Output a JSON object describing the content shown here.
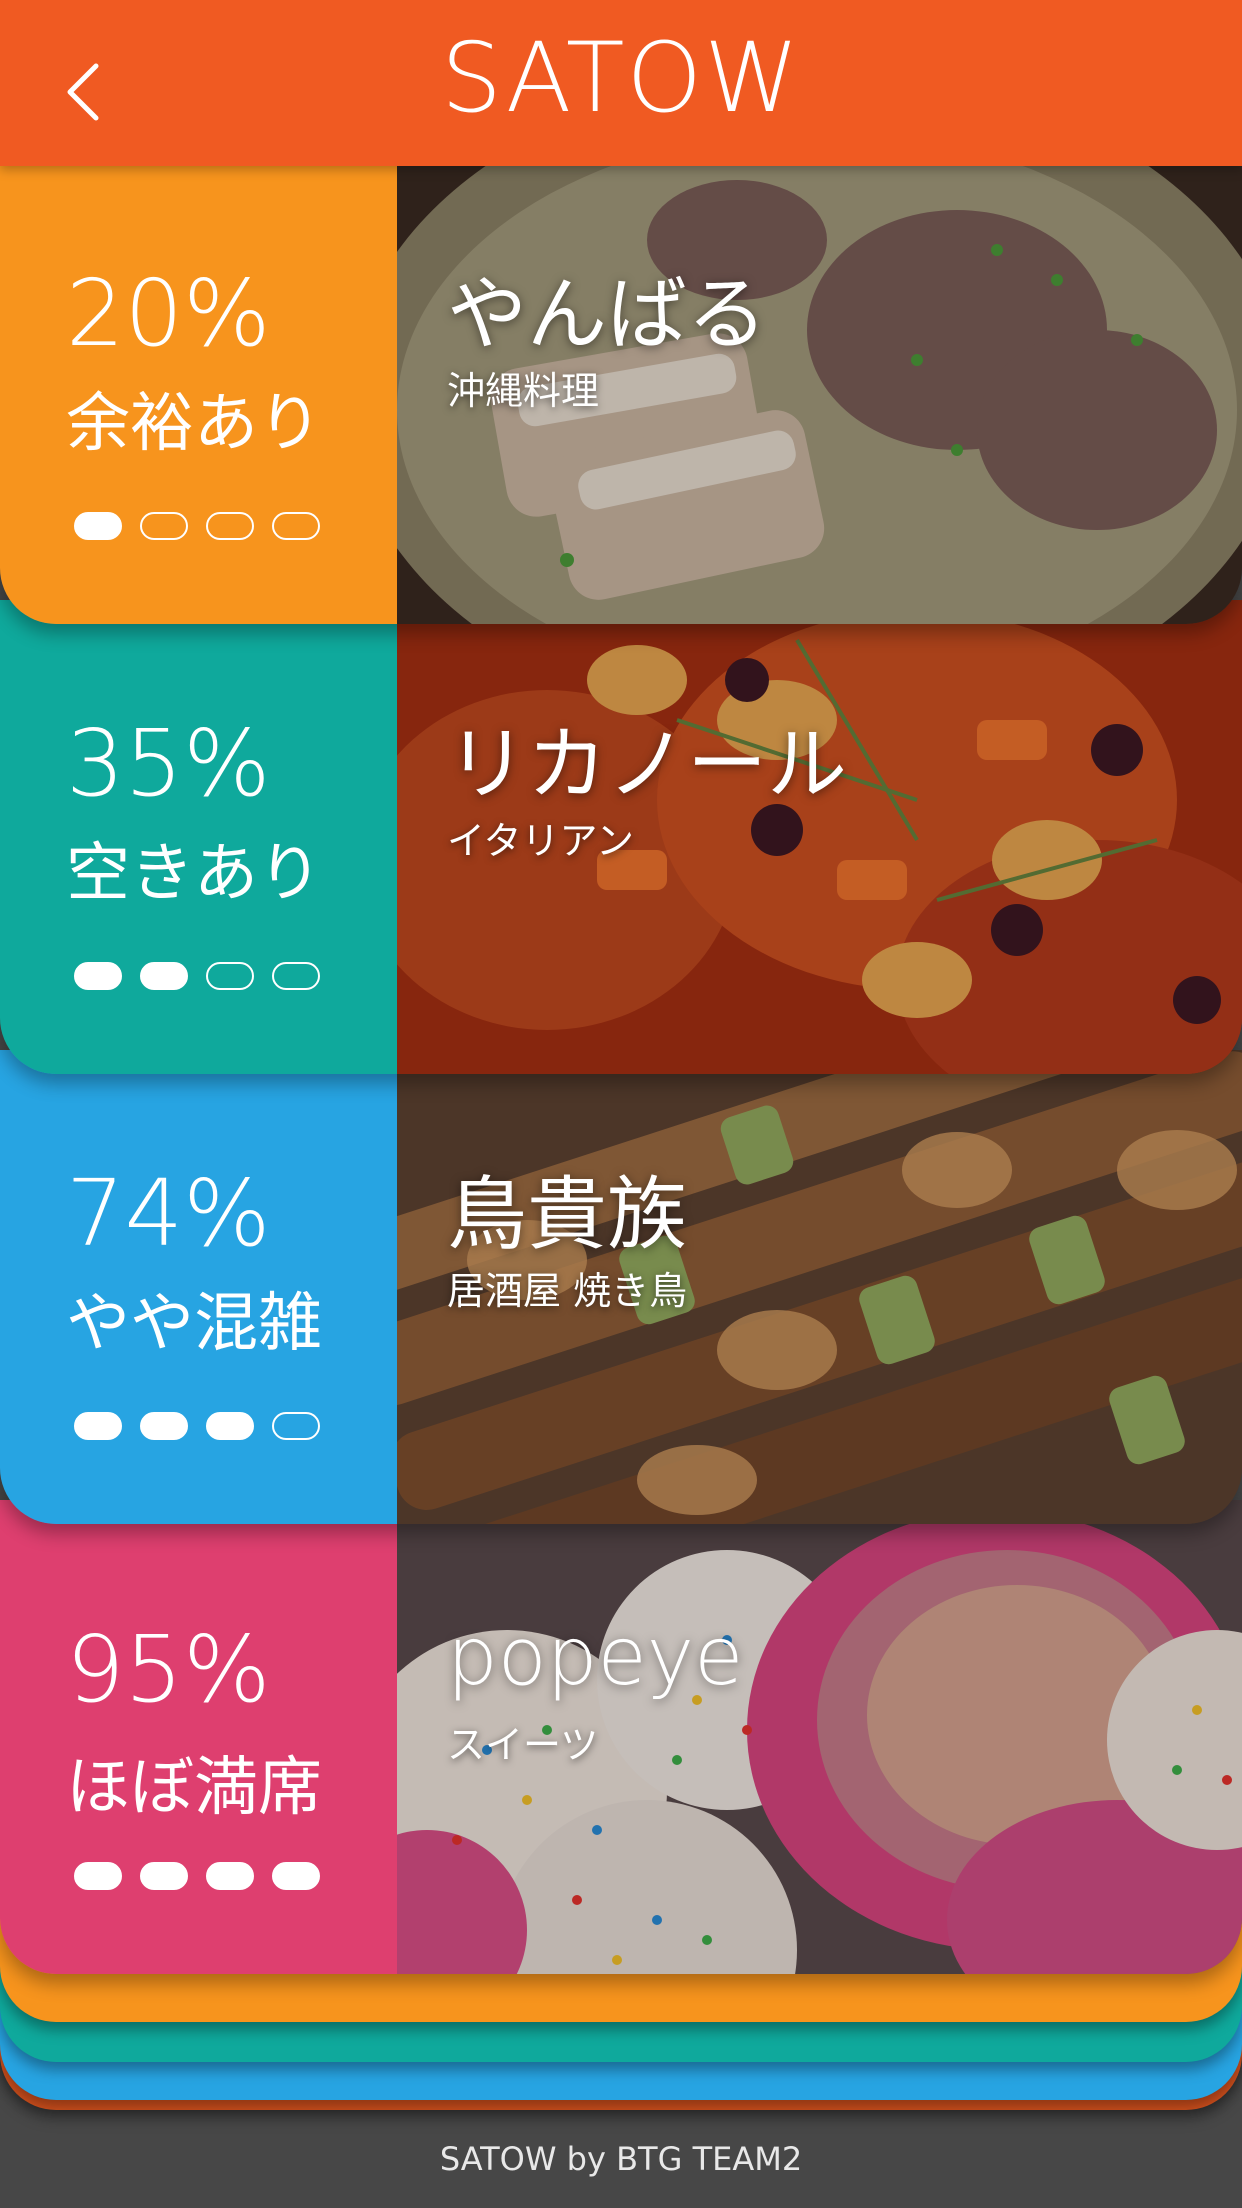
{
  "app": {
    "title": "SATOW",
    "back_icon": "chevron-left-icon"
  },
  "restaurants": [
    {
      "percent": "20%",
      "status": "余裕あり",
      "level": 1,
      "name": "やんばる",
      "genre": "沖縄料理",
      "color": "#f7941d",
      "image": "pork-soup-photo"
    },
    {
      "percent": "35%",
      "status": "空きあり",
      "level": 2,
      "name": "リカノール",
      "genre": "イタリアン",
      "color": "#0fa99c",
      "image": "italian-stew-photo"
    },
    {
      "percent": "74%",
      "status": "やや混雑",
      "level": 3,
      "name": "鳥貴族",
      "genre": "居酒屋 焼き鳥",
      "color": "#27a4e2",
      "image": "yakitori-photo"
    },
    {
      "percent": "95%",
      "status": "ほぼ満席",
      "level": 4,
      "name": "popeye",
      "genre": "スイーツ",
      "color": "#de3f6f",
      "image": "cake-pops-photo"
    }
  ],
  "footer": {
    "text": "SATOW by BTG TEAM2"
  }
}
